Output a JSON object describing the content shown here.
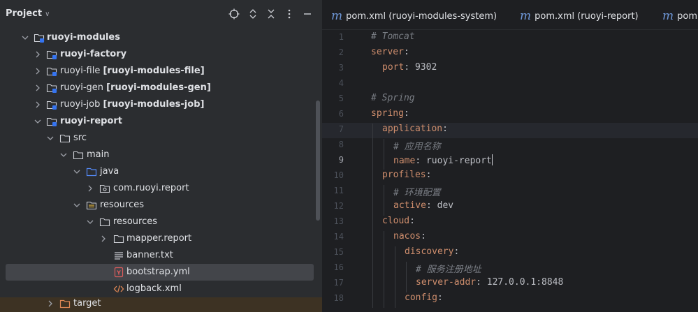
{
  "project_panel": {
    "title": "Project",
    "header_icons": [
      "crosshair-icon",
      "expand-all-icon",
      "collapse-all-icon",
      "more-icon",
      "hide-icon"
    ],
    "tree": [
      {
        "name": "ruoyi-modules",
        "suffix": "",
        "expanded": true,
        "icon": "module-folder",
        "bold": true
      },
      {
        "name": "ruoyi-factory",
        "suffix": "",
        "expanded": false,
        "icon": "module-folder",
        "bold": true
      },
      {
        "name": "ruoyi-file",
        "suffix": "[ruoyi-modules-file]",
        "expanded": false,
        "icon": "module-folder",
        "bold": false
      },
      {
        "name": "ruoyi-gen",
        "suffix": "[ruoyi-modules-gen]",
        "expanded": false,
        "icon": "module-folder",
        "bold": false
      },
      {
        "name": "ruoyi-job",
        "suffix": "[ruoyi-modules-job]",
        "expanded": false,
        "icon": "module-folder",
        "bold": false
      },
      {
        "name": "ruoyi-report",
        "suffix": "",
        "expanded": true,
        "icon": "module-folder",
        "bold": true
      },
      {
        "name": "src",
        "suffix": "",
        "expanded": true,
        "icon": "folder",
        "bold": false
      },
      {
        "name": "main",
        "suffix": "",
        "expanded": true,
        "icon": "folder",
        "bold": false
      },
      {
        "name": "java",
        "suffix": "",
        "expanded": true,
        "icon": "source-folder",
        "bold": false
      },
      {
        "name": "com.ruoyi.report",
        "suffix": "",
        "expanded": false,
        "icon": "package",
        "bold": false
      },
      {
        "name": "resources",
        "suffix": "",
        "expanded": true,
        "icon": "resources-folder",
        "bold": false
      },
      {
        "name": "resources",
        "suffix": "",
        "expanded": true,
        "icon": "folder",
        "bold": false
      },
      {
        "name": "mapper.report",
        "suffix": "",
        "expanded": false,
        "icon": "folder",
        "bold": false
      },
      {
        "name": "banner.txt",
        "suffix": "",
        "expanded": null,
        "icon": "text-file",
        "bold": false
      },
      {
        "name": "bootstrap.yml",
        "suffix": "",
        "expanded": null,
        "icon": "yaml-file",
        "bold": false,
        "selected": true
      },
      {
        "name": "logback.xml",
        "suffix": "",
        "expanded": null,
        "icon": "xml-file",
        "bold": false
      },
      {
        "name": "target",
        "suffix": "",
        "expanded": false,
        "icon": "excluded-folder",
        "bold": false
      }
    ]
  },
  "editor": {
    "tabs": [
      {
        "prefix": "m",
        "label": "pom.xml (ruoyi-modules-system)"
      },
      {
        "prefix": "m",
        "label": "pom.xml (ruoyi-report)"
      },
      {
        "prefix": "m",
        "label": "pom.xml (ruoyi-modules-gen)"
      }
    ],
    "current_line": 9,
    "lines": [
      {
        "n": "1",
        "key": "",
        "val": "",
        "comment": "# Tomcat"
      },
      {
        "n": "2",
        "key": "server",
        "val": "",
        "comment": ""
      },
      {
        "n": "3",
        "key": "port",
        "val": "9302",
        "comment": ""
      },
      {
        "n": "4",
        "key": "",
        "val": "",
        "comment": ""
      },
      {
        "n": "5",
        "key": "",
        "val": "",
        "comment": "# Spring"
      },
      {
        "n": "6",
        "key": "spring",
        "val": "",
        "comment": ""
      },
      {
        "n": "7",
        "key": "application",
        "val": "",
        "comment": ""
      },
      {
        "n": "8",
        "key": "",
        "val": "",
        "comment": "# 应用名称"
      },
      {
        "n": "9",
        "key": "name",
        "val": "ruoyi-report",
        "comment": ""
      },
      {
        "n": "10",
        "key": "profiles",
        "val": "",
        "comment": ""
      },
      {
        "n": "11",
        "key": "",
        "val": "",
        "comment": "# 环境配置"
      },
      {
        "n": "12",
        "key": "active",
        "val": "dev",
        "comment": ""
      },
      {
        "n": "13",
        "key": "cloud",
        "val": "",
        "comment": ""
      },
      {
        "n": "14",
        "key": "nacos",
        "val": "",
        "comment": ""
      },
      {
        "n": "15",
        "key": "discovery",
        "val": "",
        "comment": ""
      },
      {
        "n": "16",
        "key": "",
        "val": "",
        "comment": "# 服务注册地址"
      },
      {
        "n": "17",
        "key": "server-addr",
        "val": "127.0.0.1:8848",
        "comment": ""
      },
      {
        "n": "18",
        "key": "config",
        "val": "",
        "comment": ""
      }
    ]
  },
  "colors": {
    "panel_bg": "#2b2d30",
    "editor_bg": "#1e1f22",
    "selection": "#43454a",
    "yaml_key": "#cf8e6d",
    "comment": "#7a7e85",
    "xml_m": "#6f98d9"
  }
}
